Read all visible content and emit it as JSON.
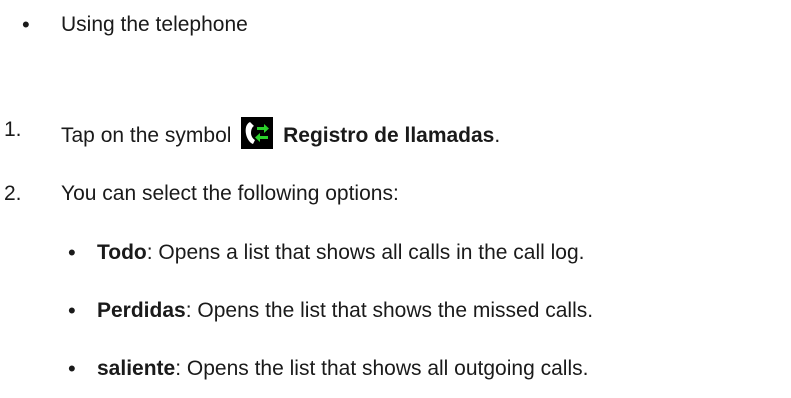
{
  "section": {
    "bullet": "•",
    "title": "Using the telephone"
  },
  "steps": [
    {
      "number": "1.",
      "prefix": "Tap on the symbol",
      "icon": "call-log-icon",
      "bold": "Registro de llamadas",
      "suffix": "."
    },
    {
      "number": "2.",
      "text": "You can select the following options:"
    }
  ],
  "options": [
    {
      "bullet": "•",
      "name": "Todo",
      "desc": ": Opens a list that shows all calls in the call log."
    },
    {
      "bullet": "•",
      "name": "Perdidas",
      "desc": ": Opens the list that shows the missed calls."
    },
    {
      "bullet": "•",
      "name": "saliente",
      "desc": ": Opens the list that shows all outgoing calls."
    }
  ],
  "colors": {
    "icon_background": "#000000",
    "icon_handset": "#ffffff",
    "icon_arrows": "#2bd12b"
  }
}
